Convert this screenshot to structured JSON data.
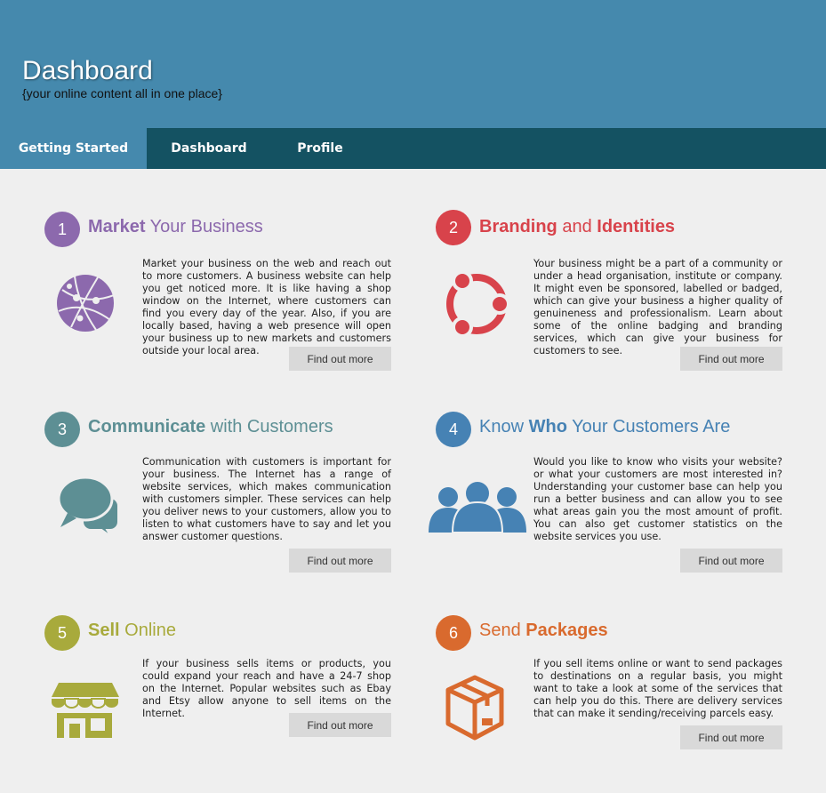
{
  "header": {
    "title": "Dashboard",
    "subtitle": "{your online content all in one place}"
  },
  "nav": {
    "tabs": [
      {
        "label": "Getting Started",
        "active": true
      },
      {
        "label": "Dashboard",
        "active": false
      },
      {
        "label": "Profile",
        "active": false
      }
    ]
  },
  "colors": {
    "header_bg": "#4589ad",
    "nav_bg": "#145262",
    "purple": "#8c69ad",
    "red": "#d8434b",
    "teal": "#5d8f94",
    "blue": "#4682b4",
    "olive": "#a8aa3c",
    "orange": "#d96a2e"
  },
  "cards": [
    {
      "number": "1",
      "title_parts": [
        "Market",
        " Your Business"
      ],
      "icon": "globe-icon",
      "text": "Market your business on the web and reach out to more customers. A business website can help you get noticed more. It is like having a shop window on the Internet, where customers can find you every day of the year. Also, if you are locally based, having a web presence will open your business up to new markets and customers outside your local area.",
      "button": "Find out more"
    },
    {
      "number": "2",
      "title_parts": [
        "Branding",
        " and ",
        "Identities"
      ],
      "icon": "branding-icon",
      "text": "Your business might be a part of a community or under a head organisation, institute or company. It might even be sponsored, labelled or badged, which can give your business a higher quality of genuineness and professionalism. Learn about some of the online badging and branding services, which can give your business for customers to see.",
      "button": "Find out more"
    },
    {
      "number": "3",
      "title_parts": [
        "Communicate",
        " with Customers"
      ],
      "icon": "chat-icon",
      "text": "Communication with customers is important for your business. The Internet has a range of website services, which makes communication with customers simpler. These services can help you deliver news to your customers, allow you to listen to what customers have to say and let you answer customer questions.",
      "button": "Find out more"
    },
    {
      "number": "4",
      "title_parts": [
        "Know ",
        "Who",
        " Your Customers Are"
      ],
      "icon": "people-icon",
      "text": "Would you like to know who visits your website? or what your customers are most interested in? Understanding your customer base can help you run a better business and can allow you to see what areas gain you the most amount of profit. You can also get customer statistics on the website services you use.",
      "button": "Find out more"
    },
    {
      "number": "5",
      "title_parts": [
        "Sell",
        " Online"
      ],
      "icon": "shop-icon",
      "text": "If your business sells items or products, you could expand your reach and have a 24-7 shop on the Internet. Popular websites such as Ebay and Etsy allow anyone to sell items on the Internet.",
      "button": "Find out more"
    },
    {
      "number": "6",
      "title_parts": [
        "Send ",
        "Packages"
      ],
      "icon": "package-icon",
      "text": "If you sell items online or want to send packages to destinations on a regular basis, you might want to take a look at some of the services that can help you do this. There are delivery services that can make it sending/receiving parcels easy.",
      "button": "Find out more"
    }
  ]
}
